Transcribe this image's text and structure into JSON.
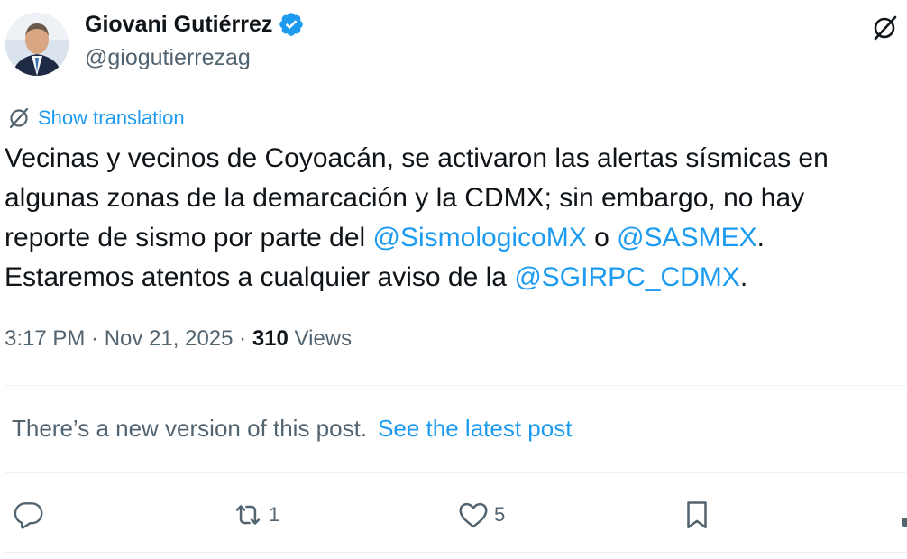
{
  "author": {
    "name": "Giovani Gutiérrez",
    "handle": "@giogutierrezag"
  },
  "translation": {
    "label": "Show translation"
  },
  "tweet": {
    "segments": {
      "line1": "Vecinas y vecinos de Coyoacán, se activaron las alertas sísmicas en",
      "line2": "algunas zonas de la demarcación y la CDMX; sin embargo, no hay",
      "line3_pre": "reporte de sismo por parte del ",
      "mention1": "@SismologicoMX",
      "line3_mid": " o ",
      "mention2": "@SASMEX",
      "line3_post": ".",
      "line4_pre": "Estaremos atentos a cualquier aviso de la ",
      "mention3": "@SGIRPC_CDMX",
      "line4_post": "."
    }
  },
  "meta": {
    "time": "3:17 PM",
    "sep1": " · ",
    "date": "Nov 21, 2025",
    "sep2": " · ",
    "views_count": "310",
    "views_label": " Views"
  },
  "notice": {
    "text": "There’s a new version of this post.",
    "link": "See the latest post"
  },
  "actions": {
    "reply_icon": "reply-icon",
    "retweet_icon": "retweet-icon",
    "retweet_count": "1",
    "like_icon": "heart-icon",
    "like_count": "5",
    "bookmark_icon": "bookmark-icon"
  },
  "colors": {
    "accent": "#1d9bf0",
    "text": "#0f1419",
    "secondary": "#536471",
    "divider": "#eff3f4"
  }
}
